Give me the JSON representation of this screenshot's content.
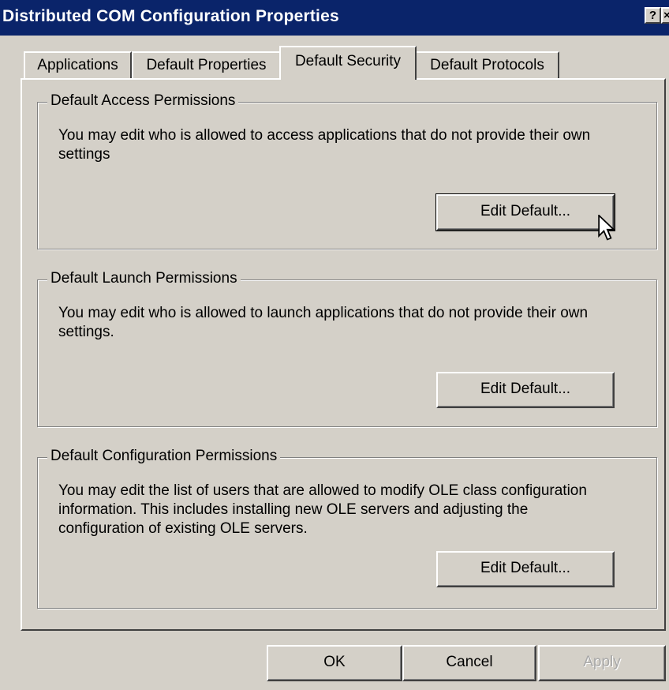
{
  "window": {
    "title": "Distributed COM Configuration Properties",
    "help_label": "?",
    "close_label": "×"
  },
  "tabs": [
    {
      "label": "Applications",
      "active": false
    },
    {
      "label": "Default Properties",
      "active": false
    },
    {
      "label": "Default Security",
      "active": true
    },
    {
      "label": "Default Protocols",
      "active": false
    }
  ],
  "groups": {
    "access": {
      "title": "Default Access Permissions",
      "description": "You may edit who is allowed to access applications that do not provide their own settings",
      "button": "Edit Default..."
    },
    "launch": {
      "title": "Default Launch Permissions",
      "description": "You may edit who is allowed to launch applications that do not provide their own settings.",
      "button": "Edit Default..."
    },
    "config": {
      "title": "Default Configuration Permissions",
      "description": "You may edit the list of users that are allowed to modify OLE class configuration information.  This includes installing new OLE servers and adjusting the configuration of existing OLE servers.",
      "button": "Edit Default..."
    }
  },
  "footer": {
    "ok": "OK",
    "cancel": "Cancel",
    "apply": "Apply"
  },
  "colors": {
    "titlebar": "#0a246a",
    "face": "#d4d0c8",
    "disabled_text": "#a8a8a8"
  },
  "icons": {
    "cursor": "mouse-pointer-icon"
  }
}
